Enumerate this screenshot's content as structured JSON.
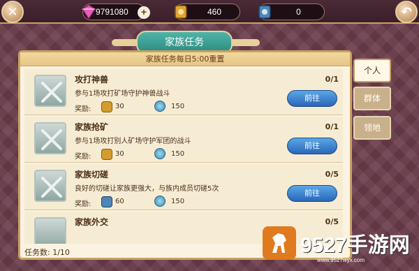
{
  "resources": {
    "gems": "9791080",
    "gold": "460",
    "badges": "0"
  },
  "window": {
    "title": "家族任务",
    "reset_notice": "家族任务每日5:00重置",
    "footer_label": "任务数:",
    "footer_value": "1/10"
  },
  "tabs": [
    "个人",
    "群体",
    "领地"
  ],
  "tasks": [
    {
      "name": "攻打神兽",
      "desc": "参与1场攻打矿场守护神兽战斗",
      "reward_label": "奖励:",
      "reward_a": "30",
      "reward_b": "150",
      "progress": "0/1",
      "button": "前往"
    },
    {
      "name": "家族抢矿",
      "desc": "参与1场攻打别人矿场守护军团的战斗",
      "reward_label": "奖励:",
      "reward_a": "30",
      "reward_b": "150",
      "progress": "0/1",
      "button": "前往"
    },
    {
      "name": "家族切磋",
      "desc": "良好的切磋让家族更强大，与族内成员切磋5次",
      "reward_label": "奖励:",
      "reward_a": "60",
      "reward_b": "150",
      "progress": "0/5",
      "button": "前往"
    },
    {
      "name": "家族外交",
      "progress": "0/5"
    }
  ],
  "watermark": {
    "text": "9527手游网",
    "url": "www.9527wyx.com"
  },
  "colors": {
    "accent_teal": "#2c8a7d",
    "button_blue": "#2b66b8",
    "frame_gold": "#c9a163"
  }
}
